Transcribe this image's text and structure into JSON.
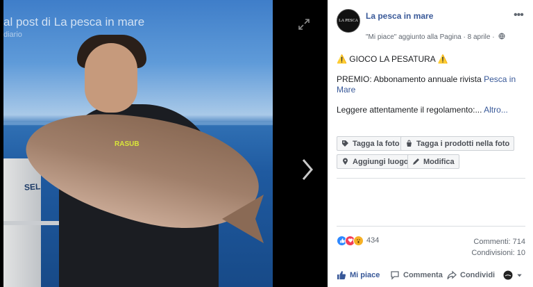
{
  "album": {
    "title": "al post di La pesca in mare",
    "subtitle": "diario"
  },
  "photo": {
    "boat_text": "SEL",
    "suit_text": "RASUB"
  },
  "page": {
    "name": "La pesca in mare",
    "avatar_text": "LA PESCA",
    "meta": "\"Mi piace\" aggiunto alla Pagina · 8 aprile ·"
  },
  "post": {
    "headline": "GIOCO LA PESATURA",
    "warn_symbol": "⚠️",
    "prize_prefix": "PREMIO: Abbonamento annuale rivista ",
    "prize_link": "Pesca in Mare",
    "rules_text": "Leggere attentamente il regolamento:...",
    "more_link": "Altro..."
  },
  "photo_actions": {
    "tag_photo": "Tagga la foto",
    "tag_products": "Tagga i prodotti nella foto",
    "add_place": "Aggiungi luogo",
    "edit": "Modifica"
  },
  "reactions": {
    "count": "434",
    "types": [
      "like",
      "love",
      "wow"
    ]
  },
  "stats": {
    "comments": "Commenti: 714",
    "shares": "Condivisioni: 10"
  },
  "actions": {
    "like": "Mi piace",
    "comment": "Commenta",
    "share": "Condividi"
  },
  "colors": {
    "link": "#385898",
    "like": "#2d88ff",
    "love": "#f33e58",
    "wow": "#f7b125"
  }
}
